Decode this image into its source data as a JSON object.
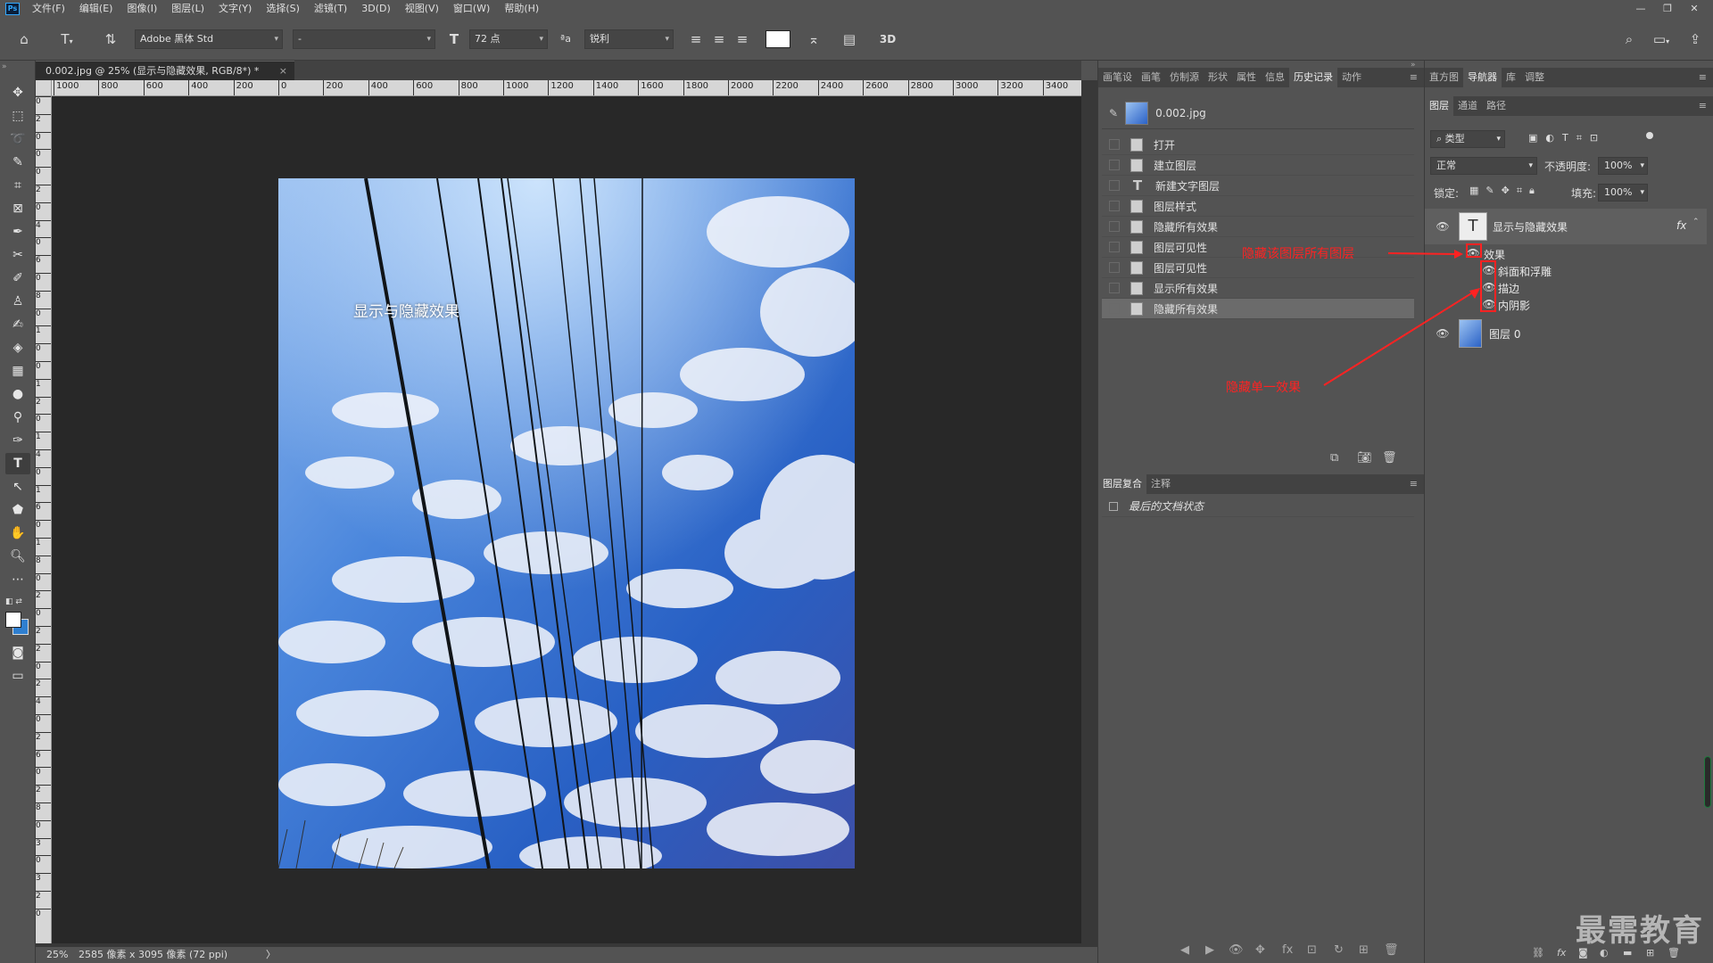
{
  "menubar": {
    "logo": "Ps",
    "items": [
      "文件(F)",
      "编辑(E)",
      "图像(I)",
      "图层(L)",
      "文字(Y)",
      "选择(S)",
      "滤镜(T)",
      "3D(D)",
      "视图(V)",
      "窗口(W)",
      "帮助(H)"
    ],
    "minimize": "—",
    "restore": "❐",
    "close": "✕"
  },
  "options": {
    "font_family": "Adobe 黑体 Std",
    "font_style": "-",
    "font_size": "72 点",
    "aa_label": "ªa",
    "anti_alias": "锐利",
    "three_d": "3D"
  },
  "document": {
    "tab_title": "0.002.jpg @ 25% (显示与隐藏效果, RGB/8*) *",
    "close": "×",
    "canvas_text": "显示与隐藏效果",
    "ruler_h": [
      "1000",
      "800",
      "600",
      "400",
      "200",
      "0",
      "200",
      "400",
      "600",
      "800",
      "1000",
      "1200",
      "1400",
      "1600",
      "1800",
      "2000",
      "2200",
      "2400",
      "2600",
      "2800",
      "3000",
      "3200",
      "3400"
    ],
    "ruler_v": [
      "0",
      "2",
      "0",
      "0",
      "0",
      "2",
      "0",
      "4",
      "0",
      "6",
      "0",
      "8",
      "0",
      "1",
      "0",
      "0",
      "1",
      "2",
      "0",
      "1",
      "4",
      "0",
      "1",
      "6",
      "0",
      "1",
      "8",
      "0",
      "2",
      "0",
      "2",
      "2",
      "0",
      "2",
      "4",
      "0",
      "2",
      "6",
      "0",
      "2",
      "8",
      "0",
      "3",
      "0",
      "3",
      "2",
      "0"
    ]
  },
  "status": {
    "zoom": "25%",
    "doc_info": "2585 像素 x 3095 像素 (72 ppi)",
    "arrow": "〉"
  },
  "mid_tabs": [
    "画笔设",
    "画笔",
    "仿制源",
    "形状",
    "属性",
    "信息",
    "历史记录",
    "动作"
  ],
  "history": {
    "snapshot": "0.002.jpg",
    "items": [
      "打开",
      "建立图层",
      "新建文字图层",
      "图层样式",
      "隐藏所有效果",
      "图层可见性",
      "图层可见性",
      "显示所有效果",
      "隐藏所有效果"
    ],
    "selected_index": 8
  },
  "comp_tabs": [
    "图层复合",
    "注释"
  ],
  "comp_state": "最后的文档状态",
  "right_top_tabs": [
    "直方图",
    "导航器",
    "库",
    "调整"
  ],
  "layer_tabs": [
    "图层",
    "通道",
    "路径"
  ],
  "layers_controls": {
    "filter_kind": "类型",
    "blend_mode": "正常",
    "opacity_label": "不透明度:",
    "opacity_value": "100%",
    "lock_label": "锁定:",
    "fill_label": "填充:",
    "fill_value": "100%"
  },
  "layers": {
    "text_layer": "显示与隐藏效果",
    "fx": "fx",
    "effects_label": "效果",
    "effects": [
      "斜面和浮雕",
      "描边",
      "内阴影"
    ],
    "image_layer": "图层 0"
  },
  "annotations": {
    "hide_all": "隐藏该图层所有图层",
    "hide_one": "隐藏单一效果"
  },
  "watermark": "最需教育",
  "colors": {
    "accent_red": "#ff2222",
    "panel_bg": "#535353",
    "canvas_bg": "#282828"
  }
}
